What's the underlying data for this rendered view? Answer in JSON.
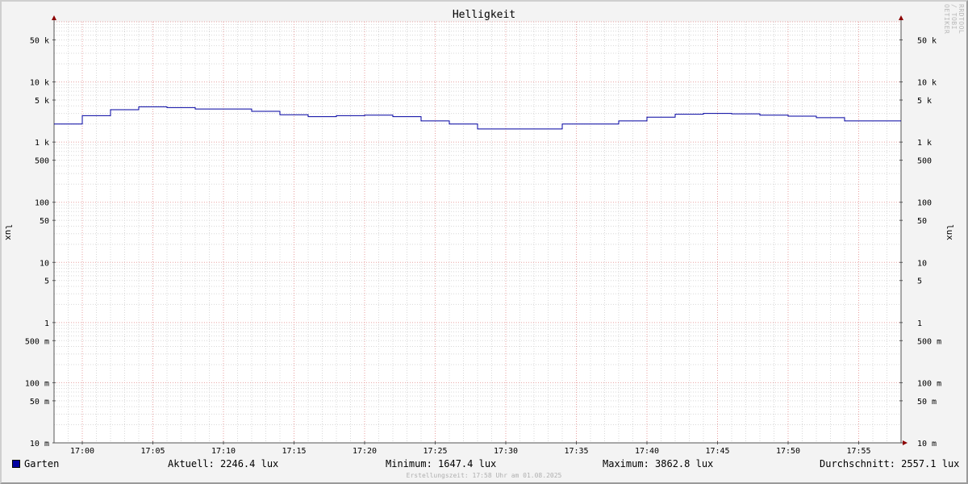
{
  "chart_data": {
    "type": "line",
    "title": "Helligkeit",
    "ylabel": "lux",
    "yscale": "log",
    "ylim": [
      0.01,
      100000
    ],
    "x_ticks": [
      "17:00",
      "17:05",
      "17:10",
      "17:15",
      "17:20",
      "17:25",
      "17:30",
      "17:35",
      "17:40",
      "17:45",
      "17:50",
      "17:55"
    ],
    "y_ticks": [
      {
        "value": 50000,
        "label": "50 k"
      },
      {
        "value": 10000,
        "label": "10 k"
      },
      {
        "value": 5000,
        "label": "5 k"
      },
      {
        "value": 1000,
        "label": "1 k"
      },
      {
        "value": 500,
        "label": "500"
      },
      {
        "value": 100,
        "label": "100"
      },
      {
        "value": 50,
        "label": "50"
      },
      {
        "value": 10,
        "label": "10"
      },
      {
        "value": 5,
        "label": "5"
      },
      {
        "value": 1,
        "label": "1"
      },
      {
        "value": 0.5,
        "label": "500 m"
      },
      {
        "value": 0.1,
        "label": "100 m"
      },
      {
        "value": 0.05,
        "label": "50 m"
      },
      {
        "value": 0.01,
        "label": "10 m"
      }
    ],
    "grid": true,
    "series": [
      {
        "name": "Garten",
        "color": "#0000a0",
        "steps": [
          {
            "x": "16:58",
            "y": 2000
          },
          {
            "x": "17:00",
            "y": 2750
          },
          {
            "x": "17:02",
            "y": 3450
          },
          {
            "x": "17:04",
            "y": 3860
          },
          {
            "x": "17:06",
            "y": 3750
          },
          {
            "x": "17:08",
            "y": 3550
          },
          {
            "x": "17:10",
            "y": 3550
          },
          {
            "x": "17:12",
            "y": 3250
          },
          {
            "x": "17:14",
            "y": 2850
          },
          {
            "x": "17:16",
            "y": 2650
          },
          {
            "x": "17:18",
            "y": 2750
          },
          {
            "x": "17:20",
            "y": 2800
          },
          {
            "x": "17:22",
            "y": 2650
          },
          {
            "x": "17:24",
            "y": 2250
          },
          {
            "x": "17:26",
            "y": 2000
          },
          {
            "x": "17:28",
            "y": 1650
          },
          {
            "x": "17:30",
            "y": 1650
          },
          {
            "x": "17:32",
            "y": 1650
          },
          {
            "x": "17:34",
            "y": 2000
          },
          {
            "x": "17:36",
            "y": 2000
          },
          {
            "x": "17:38",
            "y": 2250
          },
          {
            "x": "17:40",
            "y": 2600
          },
          {
            "x": "17:42",
            "y": 2900
          },
          {
            "x": "17:44",
            "y": 3000
          },
          {
            "x": "17:46",
            "y": 2950
          },
          {
            "x": "17:48",
            "y": 2800
          },
          {
            "x": "17:50",
            "y": 2700
          },
          {
            "x": "17:52",
            "y": 2550
          },
          {
            "x": "17:54",
            "y": 2250
          },
          {
            "x": "17:56",
            "y": 2250
          },
          {
            "x": "17:58",
            "y": 2250
          }
        ]
      }
    ]
  },
  "legend": {
    "name": "Garten",
    "current": "Aktuell: 2246.4 lux",
    "minimum": "Minimum: 1647.4 lux",
    "maximum": "Maximum: 3862.8 lux",
    "average": "Durchschnitt: 2557.1 lux"
  },
  "watermark": "RRDTOOL / TOBI OETIKER",
  "footer": "Erstellungszeit: 17:58 Uhr am 01.08.2025",
  "colors": {
    "line": "#0000a0",
    "major_grid": "#e8a0a0",
    "minor_grid": "#d8d8d8",
    "background": "#f3f3f3",
    "plot": "#ffffff"
  }
}
